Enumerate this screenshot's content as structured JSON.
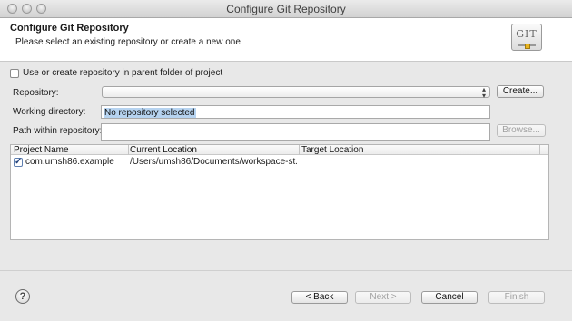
{
  "window": {
    "title": "Configure Git Repository"
  },
  "header": {
    "title": "Configure Git Repository",
    "subtitle": "Please select an existing repository or create a new one",
    "logo_text": "GIT"
  },
  "form": {
    "parent_repo_checkbox_label": "Use or create repository in parent folder of project",
    "repository_label": "Repository:",
    "repository_value": "",
    "create_button": "Create...",
    "working_dir_label": "Working directory:",
    "working_dir_value": "No repository selected",
    "path_label": "Path within repository:",
    "path_value": "",
    "browse_button": "Browse..."
  },
  "table": {
    "columns": [
      "Project Name",
      "Current Location",
      "Target Location"
    ],
    "rows": [
      {
        "checked": true,
        "project": "com.umsh86.example",
        "current": "/Users/umsh86/Documents/workspace-st...",
        "target": ""
      }
    ]
  },
  "footer": {
    "help_icon": "?",
    "back": "< Back",
    "next": "Next >",
    "cancel": "Cancel",
    "finish": "Finish"
  }
}
